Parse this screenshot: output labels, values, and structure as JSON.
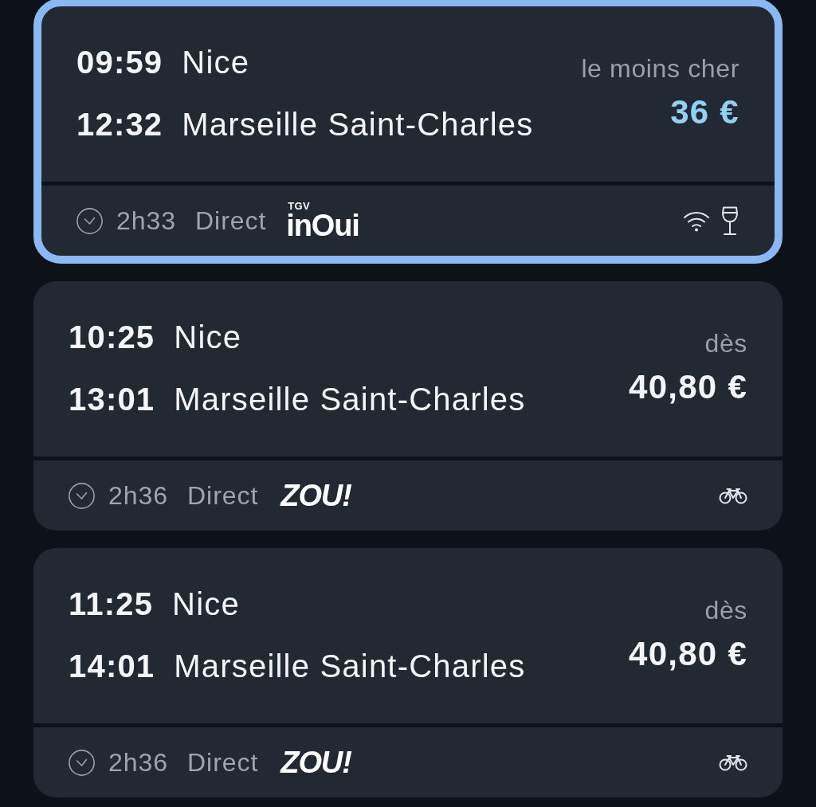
{
  "trains": [
    {
      "selected": true,
      "departure": {
        "time": "09:59",
        "station": "Nice"
      },
      "arrival": {
        "time": "12:32",
        "station": "Marseille Saint-Charles"
      },
      "fare": {
        "label": "le moins cher",
        "price": "36 €",
        "cheapest": true
      },
      "duration": "2h33",
      "type": "Direct",
      "operator": {
        "kind": "inoui",
        "label": "TGV",
        "name": "inOui"
      },
      "amenities": [
        {
          "kind": "wifi"
        },
        {
          "kind": "wine-glass"
        }
      ]
    },
    {
      "selected": false,
      "departure": {
        "time": "10:25",
        "station": "Nice"
      },
      "arrival": {
        "time": "13:01",
        "station": "Marseille Saint-Charles"
      },
      "fare": {
        "label": "dès",
        "price": "40,80 €",
        "cheapest": false
      },
      "duration": "2h36",
      "type": "Direct",
      "operator": {
        "kind": "zou",
        "name": "ZOU!"
      },
      "amenities": [
        {
          "kind": "bicycle"
        }
      ]
    },
    {
      "selected": false,
      "departure": {
        "time": "11:25",
        "station": "Nice"
      },
      "arrival": {
        "time": "14:01",
        "station": "Marseille Saint-Charles"
      },
      "fare": {
        "label": "dès",
        "price": "40,80 €",
        "cheapest": false
      },
      "duration": "2h36",
      "type": "Direct",
      "operator": {
        "kind": "zou",
        "name": "ZOU!"
      },
      "amenities": [
        {
          "kind": "bicycle"
        }
      ]
    }
  ]
}
